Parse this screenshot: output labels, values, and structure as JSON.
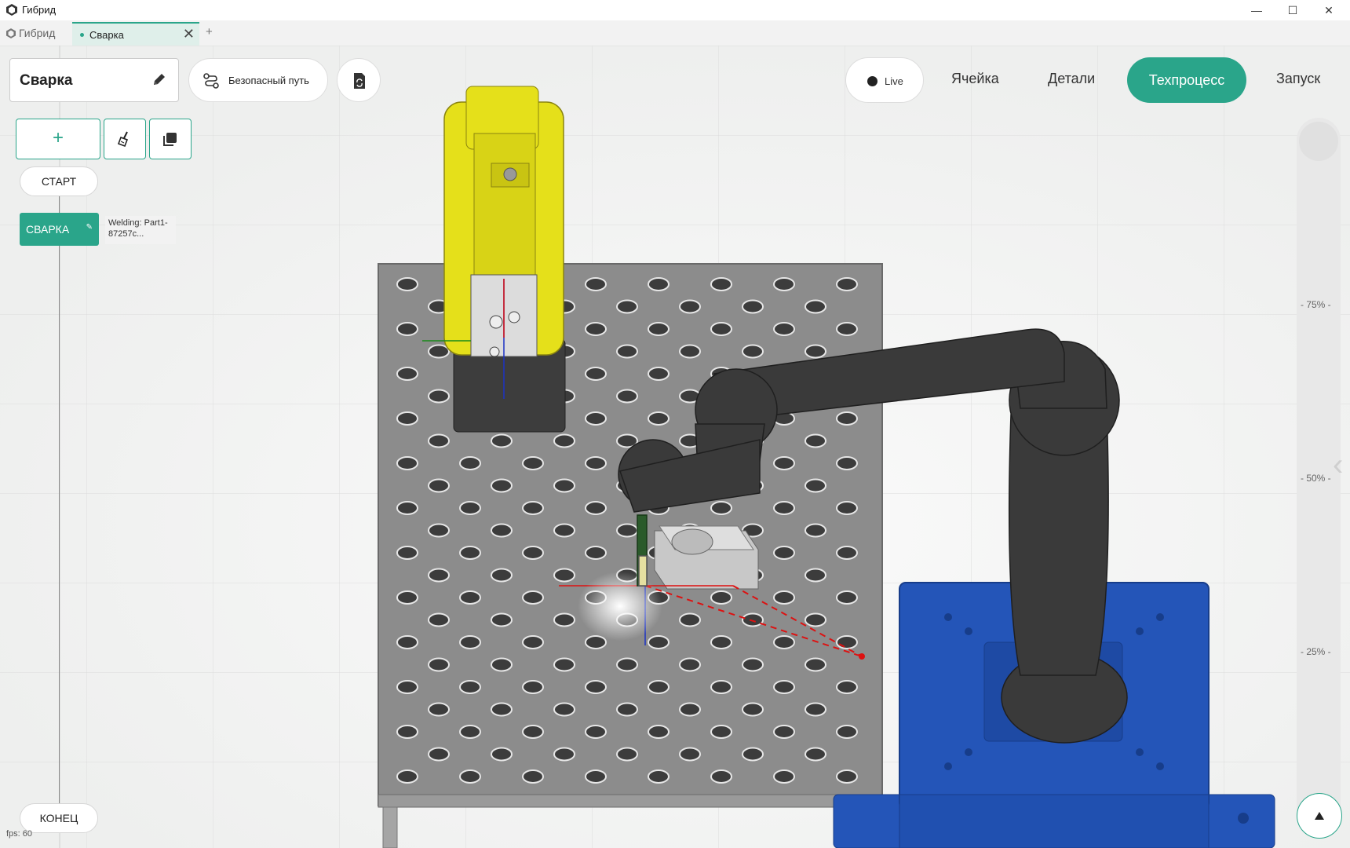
{
  "window": {
    "title": "Гибрид",
    "minimize": "—",
    "maximize": "☐",
    "close": "✕"
  },
  "tabs": {
    "home_label": "Гибрид",
    "active_tab": "Сварка",
    "close_glyph": "✕",
    "new_tab_glyph": "+"
  },
  "toolbar": {
    "process_name": "Сварка",
    "safe_path_label": "Безопасный путь"
  },
  "process_editor": {
    "add_step_glyph": "+",
    "start_label": "СТАРТ",
    "end_label": "КОНЕЦ",
    "weld_step_label": "СВАРКА",
    "weld_step_detail_line1": "Welding: Part1-",
    "weld_step_detail_line2": "87257c..."
  },
  "nav": {
    "live_label": "Live",
    "cell": "Ячейка",
    "parts": "Детали",
    "process": "Техпроцесс",
    "launch": "Запуск",
    "active": "Техпроцесс"
  },
  "zoom": {
    "tick_75": "- 75% -",
    "tick_50": "- 50% -",
    "tick_25": "- 25% -"
  },
  "status": {
    "fps": "fps: 60"
  },
  "colors": {
    "accent": "#2aa58a",
    "table": "#8c8c8c",
    "robot_yellow": "#e5e01a",
    "robot_dark": "#3a3a3a",
    "base_blue": "#1f4fb2"
  }
}
